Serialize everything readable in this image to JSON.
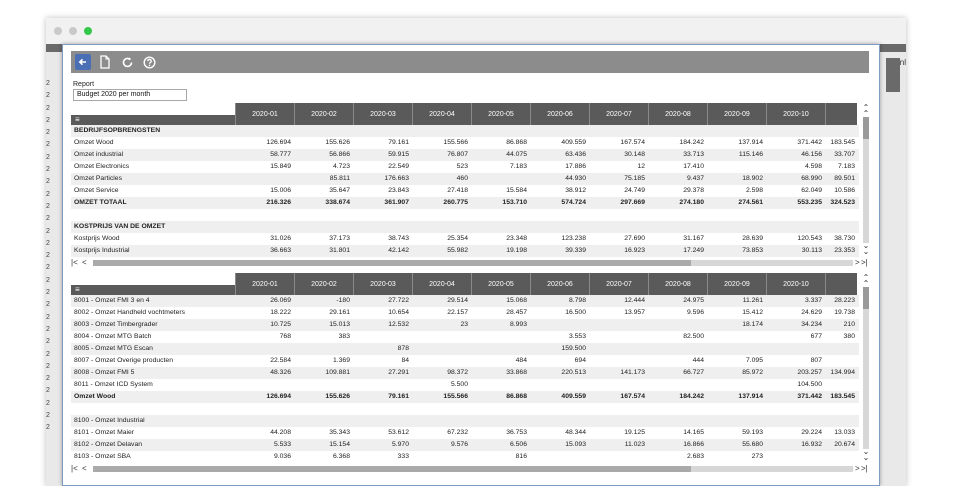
{
  "window": {
    "right_partial_text": "nl"
  },
  "background_rows": [
    "2",
    "2",
    "2",
    "2",
    "2",
    "2",
    "2",
    "2",
    "2",
    "2",
    "2",
    "2",
    "2",
    "2",
    "2",
    "2",
    "2",
    "2",
    "2",
    "2",
    "2",
    "2",
    "2",
    "2",
    "2",
    "2",
    "2",
    "2",
    "2"
  ],
  "toolbar": {
    "back": "back",
    "page": "page",
    "refresh": "refresh",
    "help": "help"
  },
  "report": {
    "label": "Report",
    "value": "Budget 2020 per month"
  },
  "months": [
    "2020-01",
    "2020-02",
    "2020-03",
    "2020-04",
    "2020-05",
    "2020-06",
    "2020-07",
    "2020-08",
    "2020-09",
    "2020-10"
  ],
  "menu_glyph": "≡",
  "scroll": {
    "up": "⌃",
    "down": "⌄",
    "first": "|<",
    "prev": "<",
    "next": ">",
    "last": ">|"
  },
  "top_rows": [
    {
      "type": "section",
      "label": "BEDRIJFSOPBRENGSTEN",
      "values": [
        "",
        "",
        "",
        "",
        "",
        "",
        "",
        "",
        "",
        "",
        ""
      ]
    },
    {
      "type": "data",
      "label": "Omzet Wood",
      "values": [
        "126.694",
        "155.626",
        "79.161",
        "155.566",
        "86.868",
        "409.559",
        "167.574",
        "184.242",
        "137.914",
        "371.442",
        "183.545"
      ]
    },
    {
      "type": "data",
      "label": "Omzet industrial",
      "values": [
        "58.777",
        "56.866",
        "59.915",
        "76.807",
        "44.075",
        "63.436",
        "30.148",
        "33.713",
        "115.146",
        "46.156",
        "33.707"
      ]
    },
    {
      "type": "data",
      "label": "Omzet Electronics",
      "values": [
        "15.849",
        "4.723",
        "22.549",
        "523",
        "7.183",
        "17.886",
        "12",
        "17.410",
        "",
        "4.598",
        "7.183"
      ]
    },
    {
      "type": "data",
      "label": "Omzet Particles",
      "values": [
        "",
        "85.811",
        "176.663",
        "460",
        "",
        "44.930",
        "75.185",
        "9.437",
        "18.902",
        "68.990",
        "89.501"
      ]
    },
    {
      "type": "data",
      "label": "Omzet Service",
      "values": [
        "15.006",
        "35.647",
        "23.843",
        "27.418",
        "15.584",
        "38.912",
        "24.749",
        "29.378",
        "2.598",
        "62.049",
        "10.586"
      ]
    },
    {
      "type": "total",
      "label": "OMZET TOTAAL",
      "values": [
        "216.326",
        "338.674",
        "361.907",
        "260.775",
        "153.710",
        "574.724",
        "297.669",
        "274.180",
        "274.561",
        "553.235",
        "324.523"
      ]
    },
    {
      "type": "spacer",
      "label": "",
      "values": [
        "",
        "",
        "",
        "",
        "",
        "",
        "",
        "",
        "",
        "",
        ""
      ]
    },
    {
      "type": "section",
      "label": "KOSTPRIJS VAN DE OMZET",
      "values": [
        "",
        "",
        "",
        "",
        "",
        "",
        "",
        "",
        "",
        "",
        ""
      ]
    },
    {
      "type": "data",
      "label": "Kostprijs Wood",
      "values": [
        "31.026",
        "37.173",
        "38.743",
        "25.354",
        "23.348",
        "123.238",
        "27.690",
        "31.167",
        "28.639",
        "120.543",
        "38.730"
      ]
    },
    {
      "type": "data",
      "label": "Kostprijs Industrial",
      "values": [
        "36.663",
        "31.801",
        "42.142",
        "55.982",
        "19.198",
        "39.339",
        "16.923",
        "17.249",
        "73.853",
        "30.113",
        "23.353"
      ]
    }
  ],
  "bottom_rows": [
    {
      "type": "data",
      "label": "8001 - Omzet FMI 3 en 4",
      "values": [
        "26.069",
        "-180",
        "27.722",
        "29.514",
        "15.068",
        "8.798",
        "12.444",
        "24.975",
        "11.261",
        "3.337",
        "28.223"
      ]
    },
    {
      "type": "data",
      "label": "8002 - Omzet Handheld vochtmeters",
      "values": [
        "18.222",
        "29.161",
        "10.654",
        "22.157",
        "28.457",
        "16.500",
        "13.957",
        "9.596",
        "15.412",
        "24.629",
        "19.738"
      ]
    },
    {
      "type": "data",
      "label": "8003 - Omzet Timbergrader",
      "values": [
        "10.725",
        "15.013",
        "12.532",
        "23",
        "8.993",
        "",
        "",
        "",
        "18.174",
        "34.234",
        "210"
      ]
    },
    {
      "type": "data",
      "label": "8004 - Omzet MTG Batch",
      "values": [
        "768",
        "383",
        "",
        "",
        "",
        "3.553",
        "",
        "82.500",
        "",
        "677",
        "380"
      ]
    },
    {
      "type": "data",
      "label": "8005 - Omzet MTG Escan",
      "values": [
        "",
        "",
        "878",
        "",
        "",
        "159.500",
        "",
        "",
        "",
        "",
        ""
      ]
    },
    {
      "type": "data",
      "label": "8007 - Omzet Overige producten",
      "values": [
        "22.584",
        "1.369",
        "84",
        "",
        "484",
        "694",
        "",
        "444",
        "7.095",
        "807",
        ""
      ]
    },
    {
      "type": "data",
      "label": "8008 - Omzet FMI 5",
      "values": [
        "48.326",
        "109.881",
        "27.291",
        "98.372",
        "33.868",
        "220.513",
        "141.173",
        "66.727",
        "85.972",
        "203.257",
        "134.994"
      ]
    },
    {
      "type": "data",
      "label": "8011 - Omzet ICD System",
      "values": [
        "",
        "",
        "",
        "5.500",
        "",
        "",
        "",
        "",
        "",
        "104.500",
        ""
      ]
    },
    {
      "type": "total",
      "label": "Omzet Wood",
      "values": [
        "126.694",
        "155.626",
        "79.161",
        "155.566",
        "86.868",
        "409.559",
        "167.574",
        "184.242",
        "137.914",
        "371.442",
        "183.545"
      ]
    },
    {
      "type": "spacer",
      "label": "",
      "values": [
        "",
        "",
        "",
        "",
        "",
        "",
        "",
        "",
        "",
        "",
        ""
      ]
    },
    {
      "type": "data",
      "label": "8100 - Omzet Industrial",
      "values": [
        "",
        "",
        "",
        "",
        "",
        "",
        "",
        "",
        "",
        "",
        ""
      ]
    },
    {
      "type": "data",
      "label": "8101 - Omzet Maier",
      "values": [
        "44.208",
        "35.343",
        "53.612",
        "67.232",
        "36.753",
        "48.344",
        "19.125",
        "14.165",
        "59.193",
        "29.224",
        "13.033"
      ]
    },
    {
      "type": "data",
      "label": "8102 - Omzet Delavan",
      "values": [
        "5.533",
        "15.154",
        "5.970",
        "9.576",
        "6.506",
        "15.093",
        "11.023",
        "16.866",
        "55.680",
        "16.932",
        "20.674"
      ]
    },
    {
      "type": "data",
      "label": "8103 - Omzet SBA",
      "values": [
        "9.036",
        "6.368",
        "333",
        "",
        "816",
        "",
        "",
        "2.683",
        "273",
        "",
        ""
      ]
    }
  ]
}
